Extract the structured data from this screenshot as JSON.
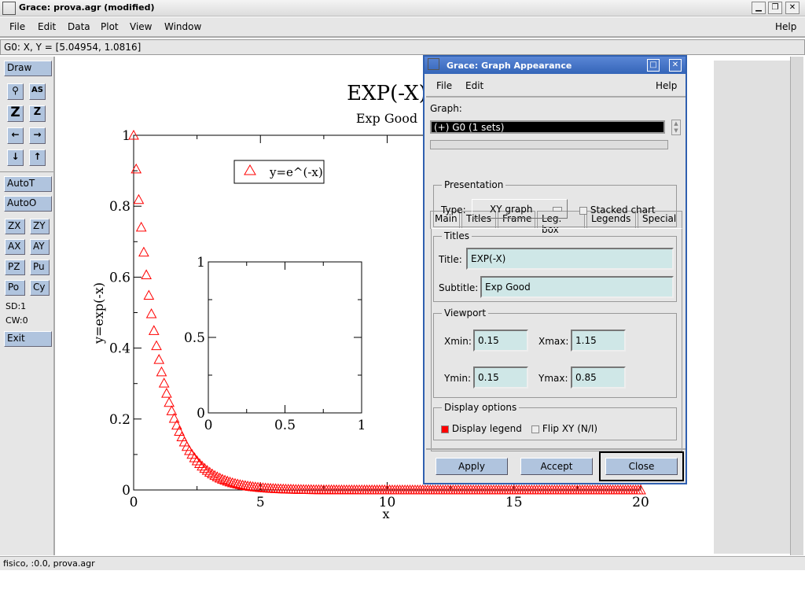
{
  "window": {
    "title": "Grace: prova.agr (modified)",
    "minimize": "▁",
    "maximize": "❐",
    "close": "✕"
  },
  "menu": {
    "file": "File",
    "edit": "Edit",
    "data": "Data",
    "plot": "Plot",
    "view": "View",
    "window": "Window",
    "help": "Help"
  },
  "locator": "G0: X, Y = [5.04954, 1.0816]",
  "toolbar": {
    "draw": "Draw",
    "autot": "AutoT",
    "autoo": "AutoO",
    "zx": "ZX",
    "zy": "ZY",
    "ax": "AX",
    "ay": "AY",
    "pz": "PZ",
    "pu": "Pu",
    "po": "Po",
    "cy": "Cy",
    "sd": "SD:1",
    "cw": "CW:0",
    "exit": "Exit",
    "icons": [
      "zoom-icon",
      "autoscale-icon",
      "zoom-in-icon",
      "zoom-out-icon",
      "left-arrow-icon",
      "right-arrow-icon",
      "down-arrow-icon",
      "up-arrow-icon"
    ]
  },
  "status": "fisico, :0.0, prova.agr",
  "chart_data": [
    {
      "type": "scatter",
      "title": "EXP(-X)",
      "subtitle": "Exp Good",
      "xlabel": "x",
      "ylabel": "y=exp(-x)",
      "xlim": [
        0,
        20
      ],
      "ylim": [
        0,
        1
      ],
      "xticks": [
        "0",
        "5",
        "10",
        "15",
        "20"
      ],
      "yticks": [
        "0",
        "0.2",
        "0.4",
        "0.6",
        "0.8",
        "1"
      ],
      "series": [
        {
          "name": "y=e^(-x)",
          "function": "exp(-x)",
          "x_range": [
            0,
            20
          ],
          "x_step": 0.1,
          "marker": "triangle",
          "color": "#ff0000"
        }
      ],
      "legend": "top-left"
    },
    {
      "type": "scatter",
      "xlim": [
        0,
        1
      ],
      "ylim": [
        0,
        1
      ],
      "xticks": [
        "0",
        "0.5",
        "1"
      ],
      "yticks": [
        "0",
        "0.5",
        "1"
      ],
      "series": []
    }
  ],
  "dialog": {
    "title": "Grace: Graph Appearance",
    "menu": {
      "file": "File",
      "edit": "Edit",
      "help": "Help"
    },
    "graph_label": "Graph:",
    "graph_item": "(+) G0 (1 sets)",
    "tabs": [
      "Main",
      "Titles",
      "Frame",
      "Leg. box",
      "Legends",
      "Special"
    ],
    "presentation": {
      "label": "Presentation",
      "type_label": "Type:",
      "type_value": "XY graph",
      "stacked": "Stacked chart"
    },
    "titles": {
      "label": "Titles",
      "title_label": "Title:",
      "title_value": "EXP(-X)",
      "subtitle_label": "Subtitle:",
      "subtitle_value": "Exp Good"
    },
    "viewport": {
      "label": "Viewport",
      "xmin_label": "Xmin:",
      "xmin": "0.15",
      "xmax_label": "Xmax:",
      "xmax": "1.15",
      "ymin_label": "Ymin:",
      "ymin": "0.15",
      "ymax_label": "Ymax:",
      "ymax": "0.85"
    },
    "display": {
      "label": "Display options",
      "legend": "Display legend",
      "legend_checked": true,
      "flip": "Flip XY (N/I)",
      "flip_checked": false
    },
    "buttons": {
      "apply": "Apply",
      "accept": "Accept",
      "close": "Close"
    }
  }
}
